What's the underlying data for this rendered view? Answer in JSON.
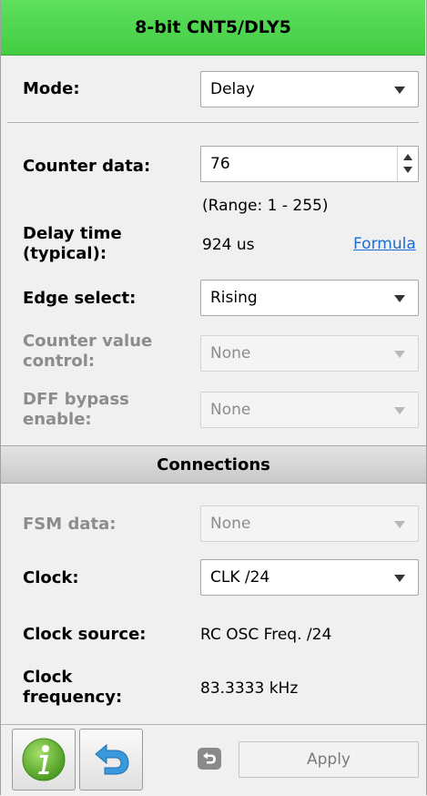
{
  "title": "8-bit CNT5/DLY5",
  "mode": {
    "label": "Mode:",
    "value": "Delay"
  },
  "counter_data": {
    "label": "Counter data:",
    "value": "76",
    "range": "(Range:  1 - 255)"
  },
  "delay_time": {
    "label_line1": "Delay time",
    "label_line2": "(typical):",
    "value": "924 us",
    "link": "Formula"
  },
  "edge_select": {
    "label": "Edge select:",
    "value": "Rising"
  },
  "counter_value_control": {
    "label_line1": "Counter value",
    "label_line2": "control:",
    "value": "None"
  },
  "dff_bypass": {
    "label_line1": "DFF bypass",
    "label_line2": "enable:",
    "value": "None"
  },
  "connections_header": "Connections",
  "fsm_data": {
    "label": "FSM data:",
    "value": "None"
  },
  "clock": {
    "label": "Clock:",
    "value": "CLK /24"
  },
  "clock_source": {
    "label": "Clock source:",
    "value": "RC OSC Freq. /24"
  },
  "clock_frequency": {
    "label_line1": "Clock",
    "label_line2": "frequency:",
    "value": "83.3333 kHz"
  },
  "apply_button": "Apply",
  "icons": {
    "info": "info-icon",
    "undo": "undo-icon"
  },
  "colors": {
    "title_bar": "#44cc44",
    "link": "#1a6dd6",
    "info_green": "#5aa830",
    "undo_blue": "#2f8fd8"
  }
}
